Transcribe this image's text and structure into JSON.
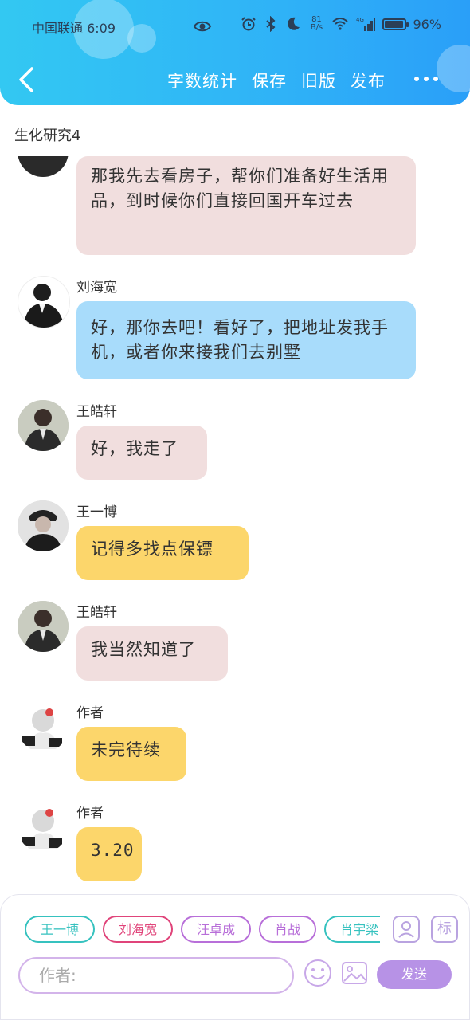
{
  "status_bar": {
    "carrier_time": "中国联通 6:09",
    "net_speed_value": "81",
    "net_speed_unit": "B/s",
    "signal_type": "4G",
    "battery_text": "96%",
    "battery_level": 0.96
  },
  "nav": {
    "word_count_label": "字数统计",
    "save_label": "保存",
    "old_version_label": "旧版",
    "publish_label": "发布"
  },
  "doc_title": "生化研究4",
  "messages": [
    {
      "sender": "",
      "text": "那我先去看房子，帮你们准备好生活用品，到时候你们直接回国开车过去",
      "bubble_color": "#f1dede"
    },
    {
      "sender": "刘海宽",
      "text": "好，那你去吧！看好了，把地址发我手机，或者你来接我们去别墅",
      "bubble_color": "#a8dcfb"
    },
    {
      "sender": "王皓轩",
      "text": "好，我走了",
      "bubble_color": "#f1dede"
    },
    {
      "sender": "王一博",
      "text": "记得多找点保镖",
      "bubble_color": "#fcd66b"
    },
    {
      "sender": "王皓轩",
      "text": "我当然知道了",
      "bubble_color": "#f1dede"
    },
    {
      "sender": "作者",
      "text": "未完待续",
      "bubble_color": "#fcd66b"
    },
    {
      "sender": "作者",
      "text": "3.20",
      "bubble_color": "#fcd66b"
    }
  ],
  "composer": {
    "characters": [
      {
        "name": "王一博",
        "color": "#36c2bf"
      },
      {
        "name": "刘海宽",
        "color": "#e0447a"
      },
      {
        "name": "汪卓成",
        "color": "#b86fd9"
      },
      {
        "name": "肖战",
        "color": "#b86fd9"
      },
      {
        "name": "肖宇梁",
        "color": "#36c2bf"
      }
    ],
    "tag_button_label": "标",
    "input_placeholder": "作者:",
    "send_label": "发送"
  }
}
